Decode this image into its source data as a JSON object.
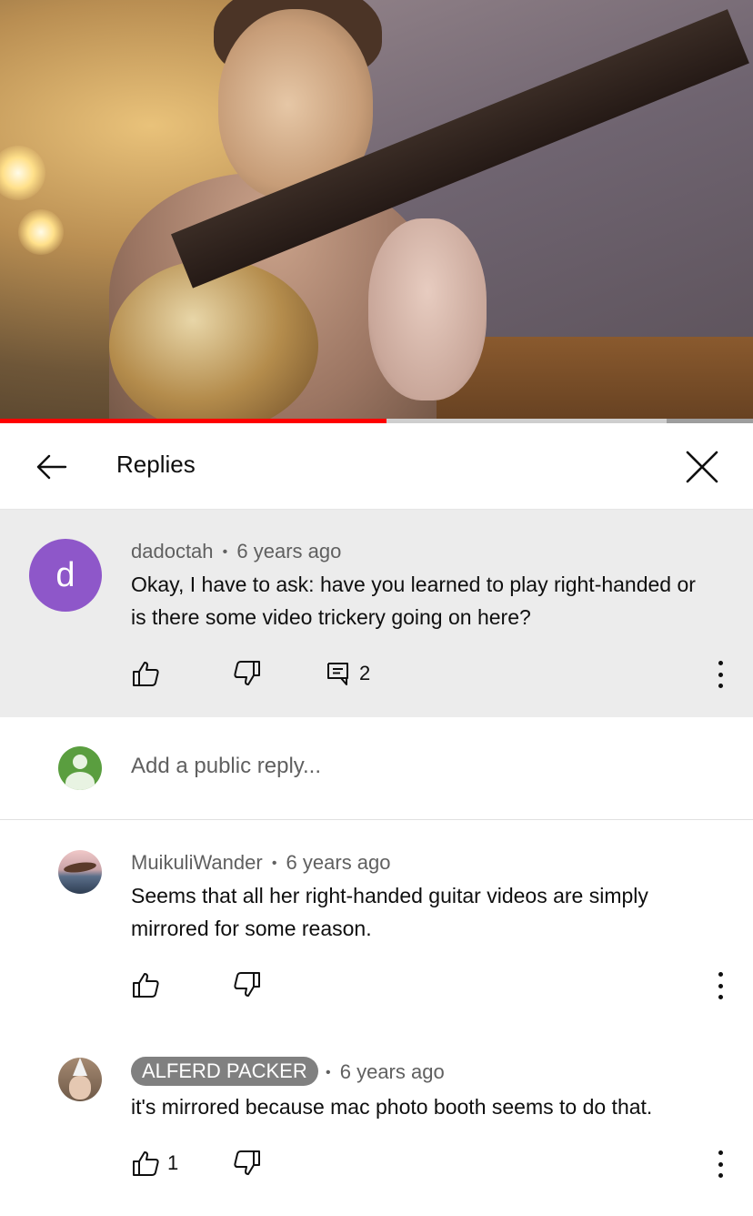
{
  "video": {
    "progress_played_fraction": 0.513,
    "progress_buffered_fraction": 0.885,
    "accent_color": "#ff0000"
  },
  "header": {
    "title": "Replies",
    "back_icon": "arrow-left-icon",
    "close_icon": "close-icon"
  },
  "parent_comment": {
    "avatar_letter": "d",
    "avatar_color": "#8e57c9",
    "author": "dadoctah",
    "separator": "•",
    "time": "6 years ago",
    "text_line1": "Okay, I have to ask: have you learned to play right-handed or",
    "text_line2": "is there some video trickery going on here?",
    "reply_count": "2"
  },
  "reply_box": {
    "placeholder": "Add a public reply..."
  },
  "replies": [
    {
      "author": "MuikuliWander",
      "separator": "•",
      "time": "6 years ago",
      "text_line1": "Seems that all her right-handed guitar videos are simply",
      "text_line2": "mirrored for some reason.",
      "likes": ""
    },
    {
      "author": "ALFERD PACKER",
      "separator": "•",
      "time": "6 years ago",
      "text_line1": "it's mirrored because mac photo booth seems to do that.",
      "likes": "1"
    }
  ]
}
